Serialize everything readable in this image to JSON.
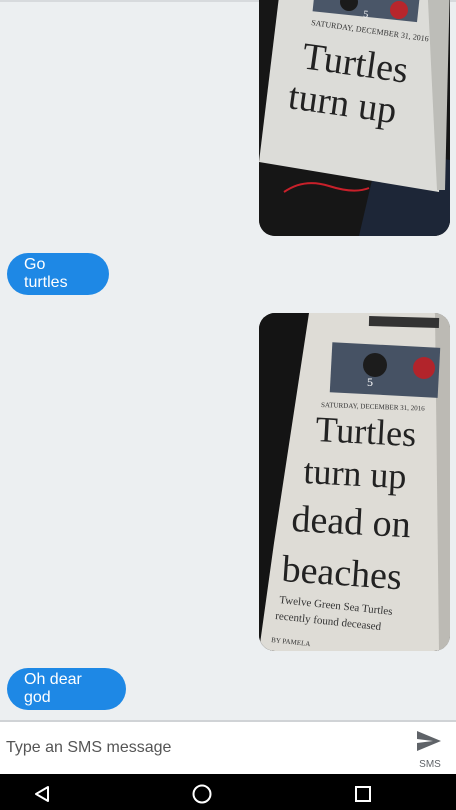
{
  "thread": {
    "messages": [
      {
        "type": "image",
        "headline": [
          "Turtles",
          "turn up"
        ],
        "dateline": "SATURDAY, DECEMBER 31, 2016",
        "jersey": "5"
      },
      {
        "type": "text",
        "text": "Go turtles"
      },
      {
        "type": "image",
        "headline": [
          "Turtles",
          "turn up",
          "dead on",
          "beaches"
        ],
        "dateline": "SATURDAY, DECEMBER 31, 2016",
        "jersey": "5",
        "subhead": [
          "Twelve Green Sea Turtles",
          "recently found deceased"
        ],
        "byline": "BY PAMELA"
      },
      {
        "type": "text",
        "text": "Oh dear god"
      }
    ]
  },
  "composer": {
    "placeholder": "Type an SMS message",
    "send_label": "SMS",
    "send_icon": "send-icon"
  },
  "navbar": {
    "icons": [
      "back-icon",
      "home-icon",
      "recents-icon"
    ]
  },
  "colors": {
    "background": "#eceff1",
    "bubble": "#1e88e5",
    "bubble_text": "#ffffff",
    "navbar": "#000000"
  }
}
